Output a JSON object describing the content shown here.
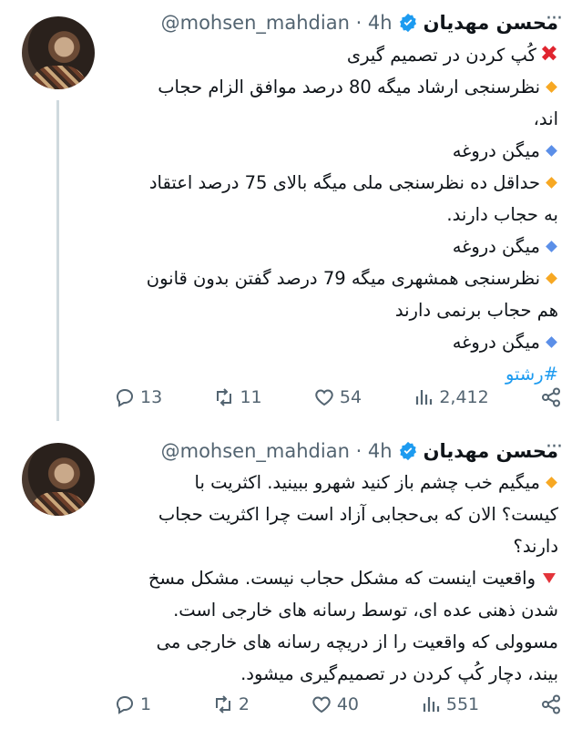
{
  "tweets": [
    {
      "name": "محسن مهدیان",
      "handle": "@mohsen_mahdian · 4h",
      "more": "···",
      "lines": [
        {
          "bullet": "x",
          "text": "کُپ کردن در تصمیم گیری"
        },
        {
          "bullet": "orange",
          "text": "نظرسنجی ارشاد میگه 80 درصد موافق الزام حجاب"
        },
        {
          "bullet": "",
          "text": "اند،"
        },
        {
          "bullet": "blue",
          "text": "میگن دروغه"
        },
        {
          "bullet": "orange",
          "text": "حداقل ده نظرسنجی ملی میگه بالای 75 درصد اعتقاد"
        },
        {
          "bullet": "",
          "text": "به حجاب دارند."
        },
        {
          "bullet": "blue",
          "text": "میگن دروغه"
        },
        {
          "bullet": "orange",
          "text": "نظرسنجی همشهری میگه 79 درصد گفتن بدون قانون"
        },
        {
          "bullet": "",
          "text": "هم حجاب برنمی دارند"
        },
        {
          "bullet": "blue",
          "text": "میگن دروغه"
        }
      ],
      "hashtag": "#رشتو",
      "stats": {
        "replies": "13",
        "retweets": "11",
        "likes": "54",
        "views": "2,412"
      }
    },
    {
      "name": "محسن مهدیان",
      "handle": "@mohsen_mahdian · 4h",
      "more": "···",
      "lines": [
        {
          "bullet": "orange",
          "text": "میگیم خب چشم باز کنید شهرو ببینید. اکثریت با"
        },
        {
          "bullet": "",
          "text": "کیست؟ الان که بی‌حجابی آزاد است چرا اکثریت حجاب"
        },
        {
          "bullet": "",
          "text": "دارند؟"
        },
        {
          "bullet": "red",
          "text": "واقعیت اینست که مشکل حجاب نیست. مشکل مسخ"
        },
        {
          "bullet": "",
          "text": "شدن ذهنی عده ای، توسط رسانه های خارجی است."
        },
        {
          "bullet": "",
          "text": "مسوولی که واقعیت را از دریچه رسانه های خارجی می"
        },
        {
          "bullet": "",
          "text": "بیند، دچار کُپ کردن در تصمیم‌گیری میشود."
        }
      ],
      "stats": {
        "replies": "1",
        "retweets": "2",
        "likes": "40",
        "views": "551"
      }
    }
  ],
  "colors": {
    "verified": "#1d9bf0",
    "muted": "#536471",
    "hashtag": "#1d9bf0"
  }
}
